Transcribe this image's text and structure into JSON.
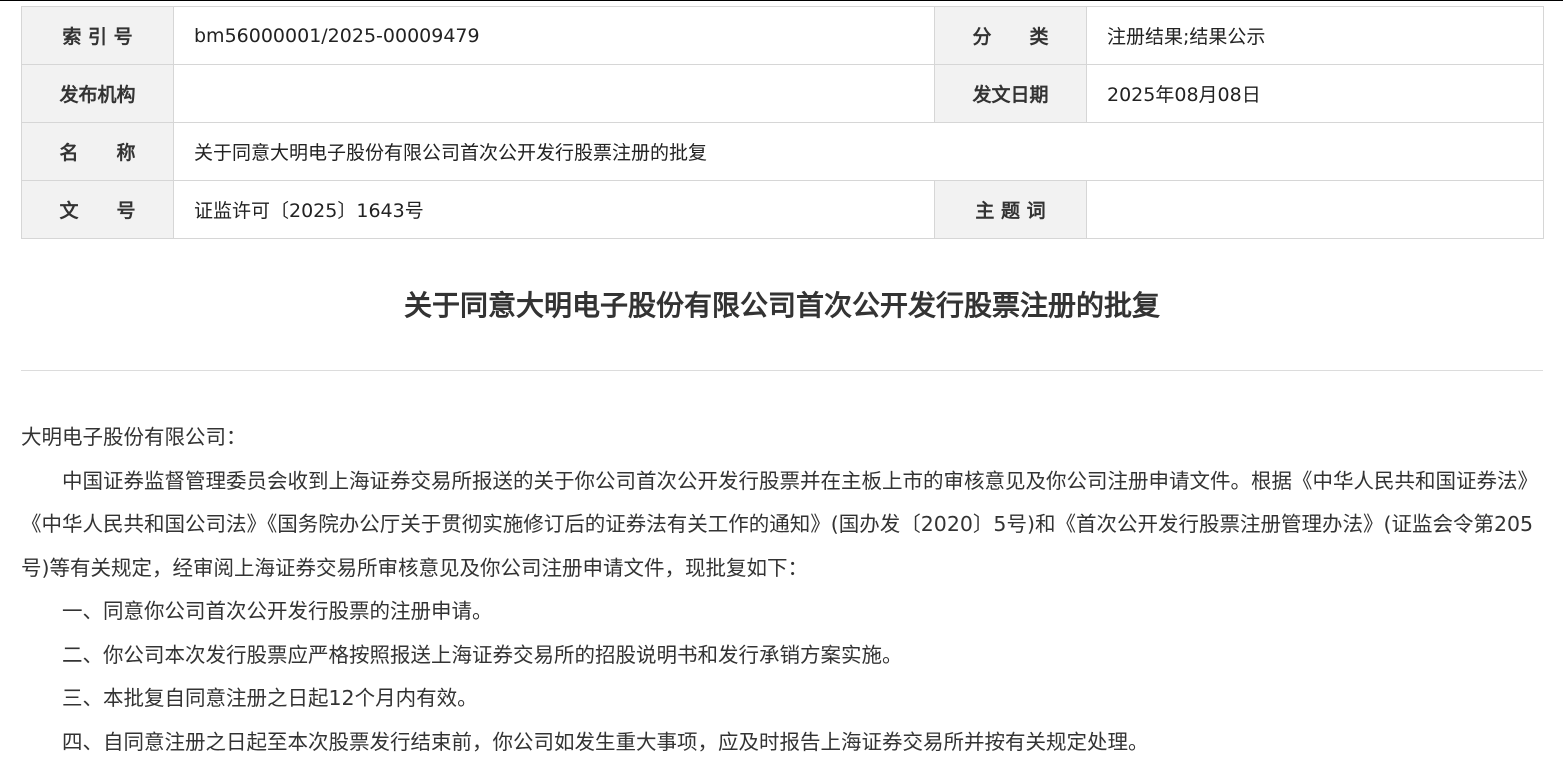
{
  "meta": {
    "index_label": "索 引 号",
    "index_value": "bm56000001/2025-00009479",
    "category_label": "分　　类",
    "category_value": "注册结果;结果公示",
    "issuer_label": "发布机构",
    "issuer_value": "",
    "date_label": "发文日期",
    "date_value": "2025年08月08日",
    "name_label": "名　　称",
    "name_value": "关于同意大明电子股份有限公司首次公开发行股票注册的批复",
    "docno_label": "文　　号",
    "docno_value": "证监许可〔2025〕1643号",
    "keywords_label": "主 题 词",
    "keywords_value": ""
  },
  "document": {
    "title": "关于同意大明电子股份有限公司首次公开发行股票注册的批复",
    "salutation": "大明电子股份有限公司：",
    "intro": "中国证券监督管理委员会收到上海证券交易所报送的关于你公司首次公开发行股票并在主板上市的审核意见及你公司注册申请文件。根据《中华人民共和国证券法》《中华人民共和国公司法》《国务院办公厅关于贯彻实施修订后的证券法有关工作的通知》(国办发〔2020〕5号)和《首次公开发行股票注册管理办法》(证监会令第205号)等有关规定，经审阅上海证券交易所审核意见及你公司注册申请文件，现批复如下：",
    "items": [
      "一、同意你公司首次公开发行股票的注册申请。",
      "二、你公司本次发行股票应严格按照报送上海证券交易所的招股说明书和发行承销方案实施。",
      "三、本批复自同意注册之日起12个月内有效。",
      "四、自同意注册之日起至本次股票发行结束前，你公司如发生重大事项，应及时报告上海证券交易所并按有关规定处理。"
    ]
  }
}
